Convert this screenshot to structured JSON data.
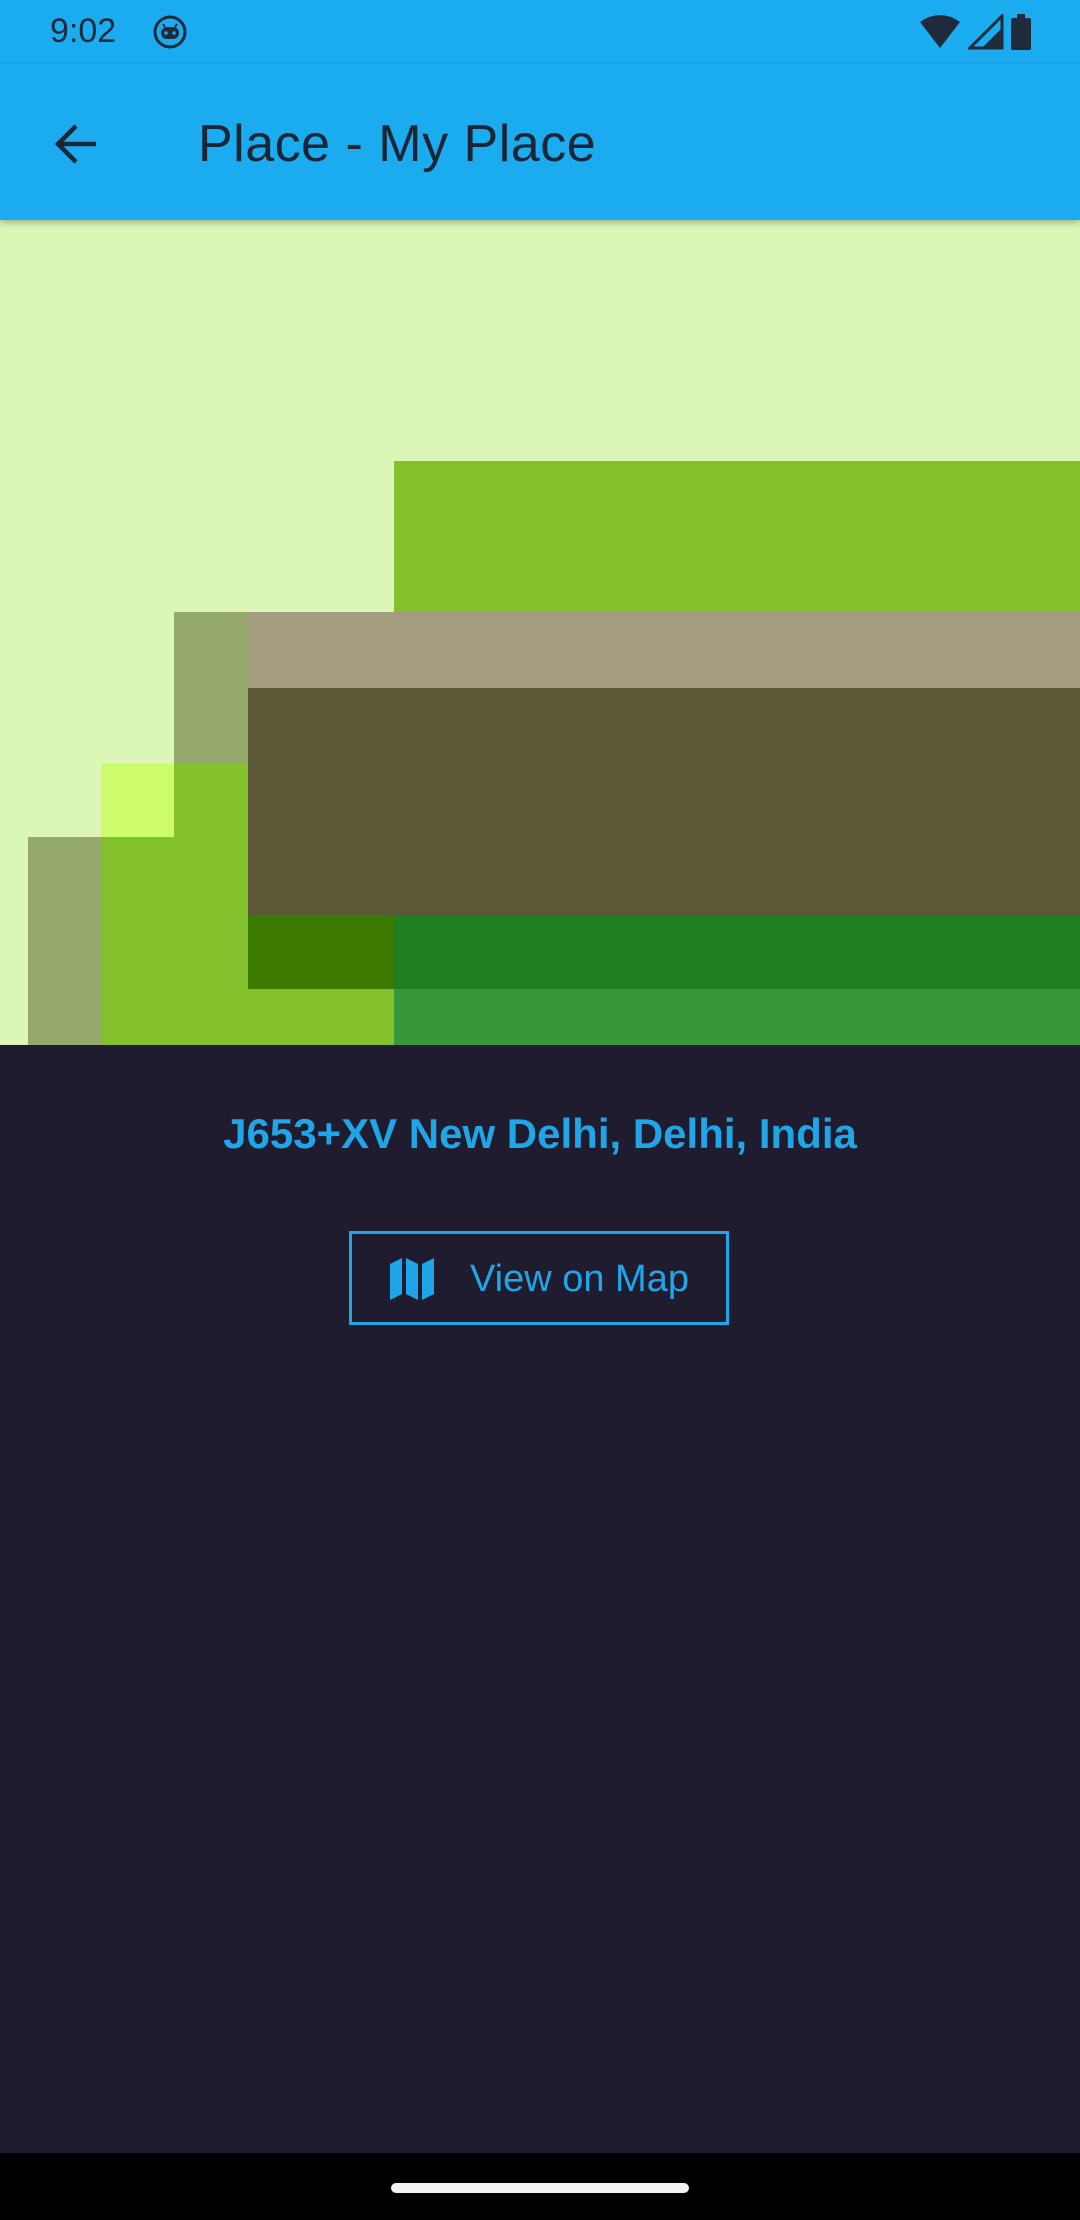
{
  "status_bar": {
    "time": "9:02",
    "icons": [
      "android-icon",
      "wifi-icon",
      "signal-icon",
      "battery-icon"
    ],
    "color": "#1bacf0"
  },
  "app_bar": {
    "title": "Place - My Place",
    "back_icon": "arrow-back-icon",
    "color": "#1bacf0"
  },
  "place": {
    "address": "J653+XV New Delhi, Delhi, India",
    "map_button_label": "View on Map",
    "map_button_icon": "map-icon"
  },
  "colors": {
    "accent": "#1ea6e8",
    "background": "#201c30"
  }
}
